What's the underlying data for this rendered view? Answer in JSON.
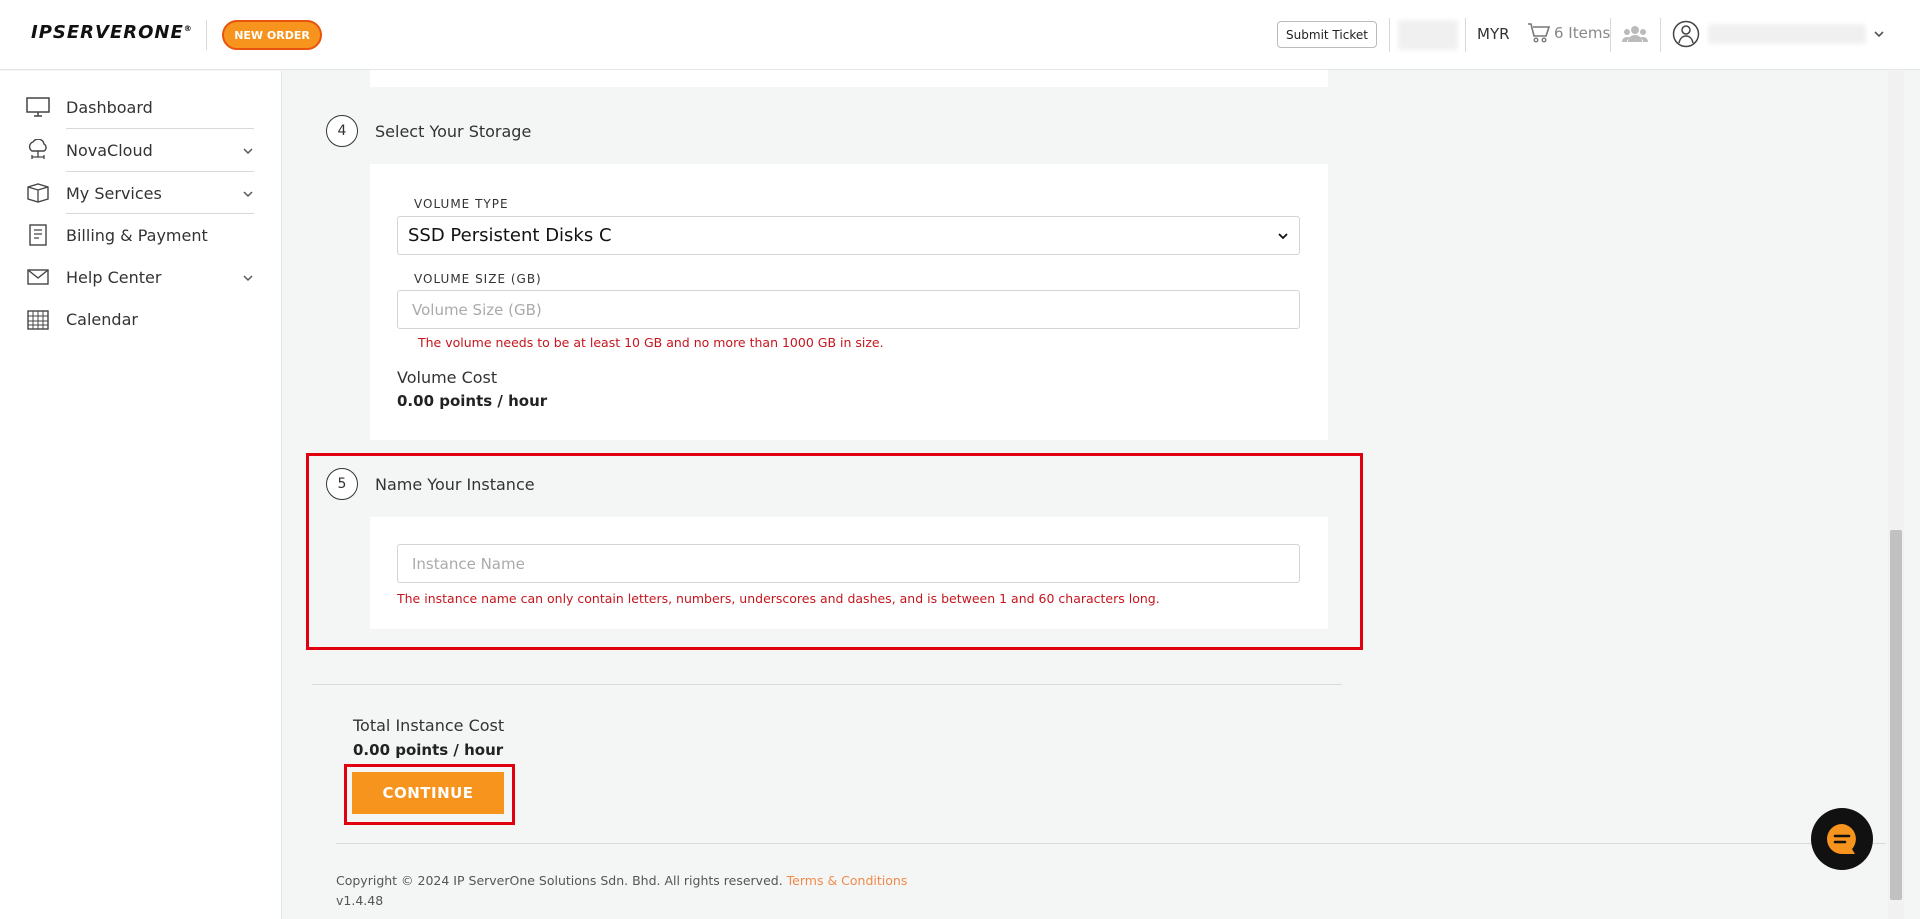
{
  "header": {
    "logo_text": "IPSERVERONE",
    "logo_mark": "®",
    "new_order_label": "NEW ORDER",
    "submit_ticket_label": "Submit Ticket",
    "currency": "MYR",
    "cart_label": "6 Items"
  },
  "sidebar": {
    "items": [
      {
        "label": "Dashboard"
      },
      {
        "label": "NovaCloud"
      },
      {
        "label": "My Services"
      },
      {
        "label": "Billing & Payment"
      },
      {
        "label": "Help Center"
      },
      {
        "label": "Calendar"
      }
    ]
  },
  "storage": {
    "step_number": "4",
    "title": "Select Your Storage",
    "volume_type_label": "VOLUME TYPE",
    "volume_type_value": "SSD Persistent Disks C",
    "volume_size_label": "VOLUME SIZE (GB)",
    "volume_size_placeholder": "Volume Size (GB)",
    "volume_size_error": "The volume needs to be at least 10 GB and no more than 1000 GB in size.",
    "cost_label": "Volume Cost",
    "cost_value": "0.00 points / hour"
  },
  "instance": {
    "step_number": "5",
    "title": "Name Your Instance",
    "name_placeholder": "Instance Name",
    "name_error": "The instance name can only contain letters, numbers, underscores and dashes, and is between 1 and 60 characters long."
  },
  "summary": {
    "total_label": "Total Instance Cost",
    "total_value": "0.00 points / hour",
    "continue_label": "CONTINUE"
  },
  "footer": {
    "copyright": "Copyright © 2024 IP ServerOne Solutions Sdn. Bhd. All rights reserved.",
    "terms_label": "Terms & Conditions",
    "version": "v1.4.48"
  },
  "colors": {
    "accent": "#f7941d",
    "error": "#c5161d",
    "highlight": "#e00010"
  }
}
